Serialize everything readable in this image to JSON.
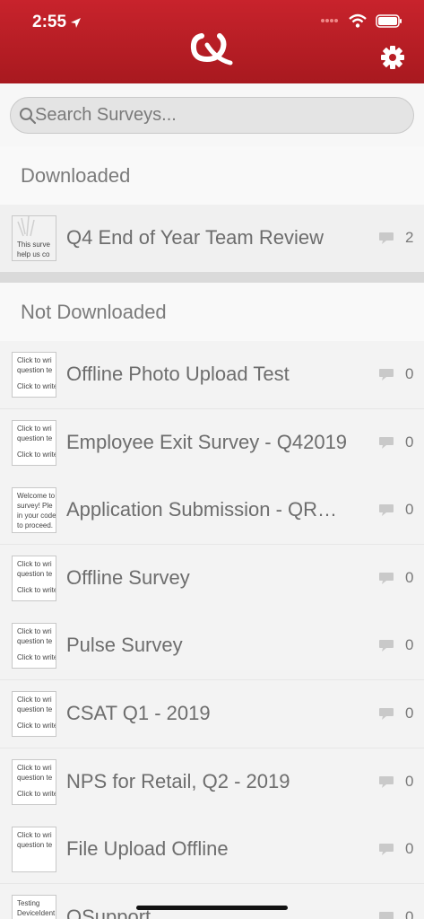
{
  "status_bar": {
    "time": "2:55"
  },
  "search": {
    "placeholder": "Search Surveys..."
  },
  "sections": {
    "downloaded_label": "Downloaded",
    "not_downloaded_label": "Not Downloaded"
  },
  "downloaded": [
    {
      "title": "Q4 End of Year Team Review",
      "count": "2",
      "thumb_lines": [
        "This surve",
        "help us co"
      ]
    }
  ],
  "not_downloaded": [
    {
      "title": "Offline Photo Upload Test",
      "count": "0",
      "thumb_lines": [
        "Click to wri",
        "question te",
        "Click to write"
      ]
    },
    {
      "title": "Employee Exit Survey - Q42019",
      "count": "0",
      "thumb_lines": [
        "Click to wri",
        "question te",
        "Click to write"
      ]
    },
    {
      "title": "Application Submission - QR…",
      "count": "0",
      "thumb_lines": [
        "Welcome to",
        "survey!  Ple",
        "in your code",
        "to proceed."
      ]
    },
    {
      "title": "Offline Survey",
      "count": "0",
      "thumb_lines": [
        "Click to wri",
        "question te",
        "Click to write"
      ]
    },
    {
      "title": "Pulse Survey",
      "count": "0",
      "thumb_lines": [
        "Click to wri",
        "question te",
        "Click to write"
      ]
    },
    {
      "title": "CSAT Q1 - 2019",
      "count": "0",
      "thumb_lines": [
        "Click to wri",
        "question te",
        "Click to write"
      ]
    },
    {
      "title": "NPS for Retail, Q2 - 2019",
      "count": "0",
      "thumb_lines": [
        "Click to wri",
        "question te",
        "Click to write"
      ]
    },
    {
      "title": "File Upload Offline",
      "count": "0",
      "thumb_lines": [
        "Click to wri",
        "question te",
        ""
      ]
    },
    {
      "title": "QSupport",
      "count": "0",
      "thumb_lines": [
        "Testing",
        "DeviceIdent",
        ""
      ]
    }
  ],
  "colors": {
    "header_red": "#b81e25",
    "row_bg": "#f3f3f3",
    "text_gray": "#6d6d6d"
  }
}
